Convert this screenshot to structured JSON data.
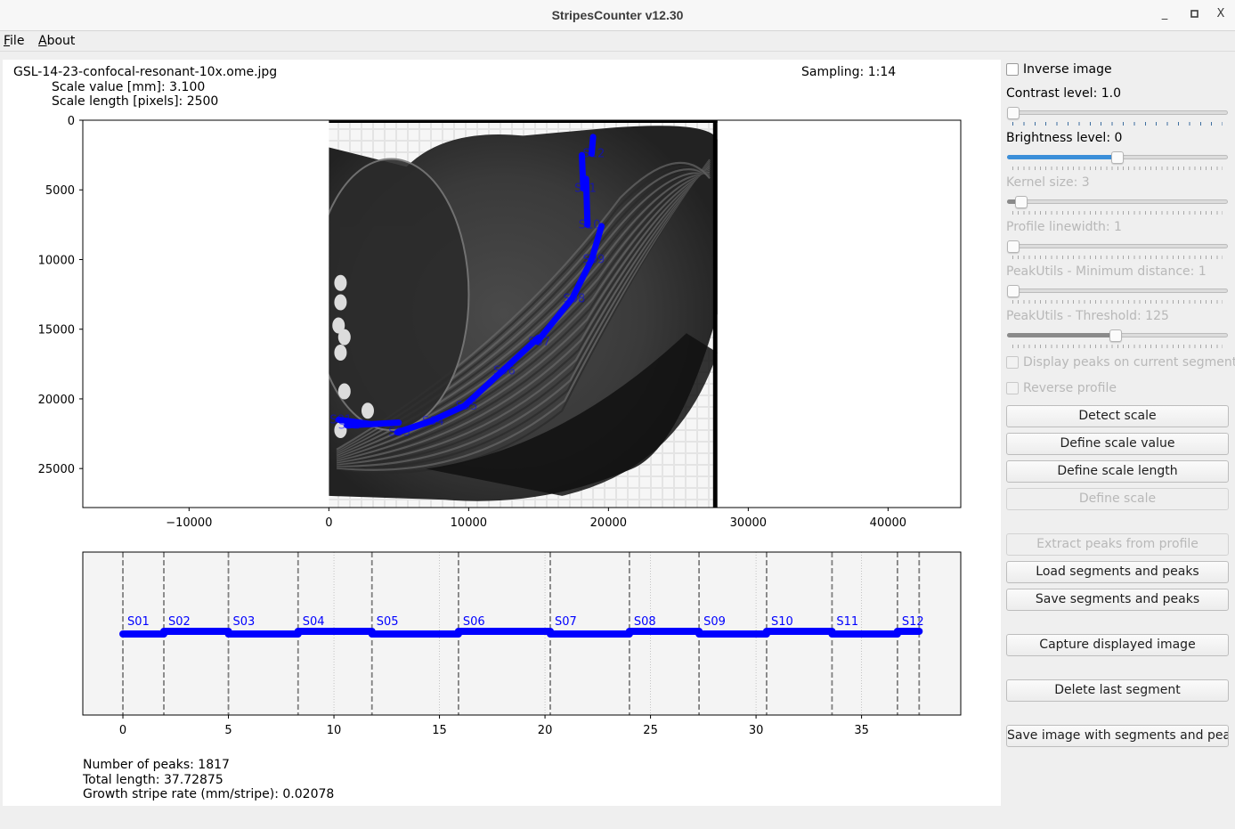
{
  "window": {
    "title": "StripesCounter v12.30",
    "controls": {
      "minimize": "_",
      "maximize": "☐",
      "close": "X"
    }
  },
  "menu": [
    {
      "label": "File",
      "mnemonic": "F",
      "rest": "ile"
    },
    {
      "label": "About",
      "mnemonic": "A",
      "rest": "bout"
    }
  ],
  "info": {
    "filename": "GSL-14-23-confocal-resonant-10x.ome.jpg",
    "scale_value": "Scale value [mm]: 3.100",
    "scale_length": "Scale length [pixels]: 2500",
    "sampling": "Sampling: 1:14"
  },
  "stats": {
    "peaks": "Number of peaks: 1817",
    "total_length": "Total length: 37.72875",
    "growth_rate": "Growth stripe rate (mm/stripe): 0.02078"
  },
  "colors": {
    "segment": "#0000ff",
    "accent": "#3b8fd9",
    "profile_bg": "#f4f4f4",
    "boundary": "#808080"
  },
  "sidebar": {
    "inverse_image": {
      "label": "Inverse image",
      "checked": false
    },
    "contrast": {
      "label": "Contrast level: 1.0",
      "value": 1.0,
      "fraction": 0.0
    },
    "brightness": {
      "label": "Brightness level: 0",
      "value": 0,
      "fraction": 0.5
    },
    "kernel": {
      "label": "Kernel size: 3",
      "value": 3,
      "fraction": 0.04,
      "disabled": true
    },
    "linewidth": {
      "label": "Profile linewidth: 1",
      "value": 1,
      "fraction": 0.0,
      "disabled": true
    },
    "min_distance": {
      "label": "PeakUtils - Minimum distance: 1",
      "value": 1,
      "fraction": 0.0,
      "disabled": true
    },
    "threshold": {
      "label": "PeakUtils - Threshold: 125",
      "value": 125,
      "fraction": 0.49,
      "disabled": true
    },
    "display_peaks": {
      "label": "Display peaks on current segment",
      "checked": false,
      "disabled": true
    },
    "reverse_profile": {
      "label": "Reverse profile",
      "checked": false,
      "disabled": true
    },
    "buttons": {
      "detect_scale": "Detect scale",
      "define_scale_value": "Define scale value",
      "define_scale_length": "Define scale length",
      "define_scale": "Define scale",
      "extract_peaks": "Extract peaks from profile",
      "load_segments": "Load segments and peaks",
      "save_segments": "Save segments and peaks",
      "capture_image": "Capture displayed image",
      "delete_segment": "Delete last segment",
      "save_image": "Save image with segments and peaks"
    }
  },
  "chart_data": [
    {
      "type": "scatter",
      "title": "",
      "description": "Otolith image with drawn segments S01–S12",
      "xlabel": "",
      "ylabel": "",
      "xlim": [
        -17600,
        45200
      ],
      "ylim": [
        27800,
        0
      ],
      "xticks": [
        -10000,
        0,
        10000,
        20000,
        30000,
        40000
      ],
      "xtick_labels": [
        "−10000",
        "0",
        "10000",
        "20000",
        "30000",
        "40000"
      ],
      "yticks": [
        0,
        5000,
        10000,
        15000,
        20000,
        25000
      ],
      "ytick_labels": [
        "0",
        "5000",
        "10000",
        "15000",
        "20000",
        "25000"
      ],
      "image_extent": [
        0,
        27800,
        27800,
        0
      ],
      "segments": [
        {
          "name": "S01",
          "points": [
            [
              700,
              21500
            ],
            [
              2900,
              21800
            ]
          ]
        },
        {
          "name": "S02",
          "points": [
            [
              1300,
              21900
            ],
            [
              5000,
              21700
            ]
          ]
        },
        {
          "name": "S03",
          "points": [
            [
              4900,
              22400
            ],
            [
              7300,
              21600
            ]
          ]
        },
        {
          "name": "S04",
          "points": [
            [
              7300,
              21600
            ],
            [
              9700,
              20500
            ]
          ]
        },
        {
          "name": "S05",
          "points": [
            [
              9700,
              20500
            ],
            [
              12400,
              18000
            ]
          ]
        },
        {
          "name": "S06",
          "points": [
            [
              12400,
              18000
            ],
            [
              15000,
              15600
            ]
          ]
        },
        {
          "name": "S07",
          "points": [
            [
              14900,
              15900
            ],
            [
              17400,
              12800
            ]
          ]
        },
        {
          "name": "S08",
          "points": [
            [
              17400,
              12800
            ],
            [
              18800,
              10000
            ]
          ]
        },
        {
          "name": "S09",
          "points": [
            [
              18800,
              10000
            ],
            [
              19500,
              7600
            ]
          ]
        },
        {
          "name": "S10",
          "points": [
            [
              18500,
              7500
            ],
            [
              18400,
              4200
            ]
          ]
        },
        {
          "name": "S11",
          "points": [
            [
              18200,
              4900
            ],
            [
              18100,
              2500
            ]
          ]
        },
        {
          "name": "S12",
          "points": [
            [
              18800,
              2400
            ],
            [
              18900,
              1200
            ]
          ]
        }
      ]
    },
    {
      "type": "line",
      "title": "",
      "description": "Profile along segments",
      "xlabel": "",
      "ylabel": "",
      "xlim": [
        -1.9,
        39.7
      ],
      "xticks": [
        0,
        5,
        10,
        15,
        20,
        25,
        30,
        35
      ],
      "xtick_labels": [
        "0",
        "5",
        "10",
        "15",
        "20",
        "25",
        "30",
        "35"
      ],
      "grid": "vertical-dotted",
      "boundaries": [
        0,
        1.94,
        5.0,
        8.3,
        11.8,
        15.9,
        20.25,
        24.0,
        27.3,
        30.5,
        33.6,
        36.7,
        37.73
      ],
      "segments": [
        {
          "name": "S01",
          "start": 0,
          "end": 1.94,
          "level": 0
        },
        {
          "name": "S02",
          "start": 1.94,
          "end": 5.0,
          "level": 1
        },
        {
          "name": "S03",
          "start": 5.0,
          "end": 8.3,
          "level": 0
        },
        {
          "name": "S04",
          "start": 8.3,
          "end": 11.8,
          "level": 1
        },
        {
          "name": "S05",
          "start": 11.8,
          "end": 15.9,
          "level": 0
        },
        {
          "name": "S06",
          "start": 15.9,
          "end": 20.25,
          "level": 1
        },
        {
          "name": "S07",
          "start": 20.25,
          "end": 24.0,
          "level": 0
        },
        {
          "name": "S08",
          "start": 24.0,
          "end": 27.3,
          "level": 1
        },
        {
          "name": "S09",
          "start": 27.3,
          "end": 30.5,
          "level": 0
        },
        {
          "name": "S10",
          "start": 30.5,
          "end": 33.6,
          "level": 1
        },
        {
          "name": "S11",
          "start": 33.6,
          "end": 36.7,
          "level": 0
        },
        {
          "name": "S12",
          "start": 36.7,
          "end": 37.73,
          "level": 1
        }
      ]
    }
  ]
}
